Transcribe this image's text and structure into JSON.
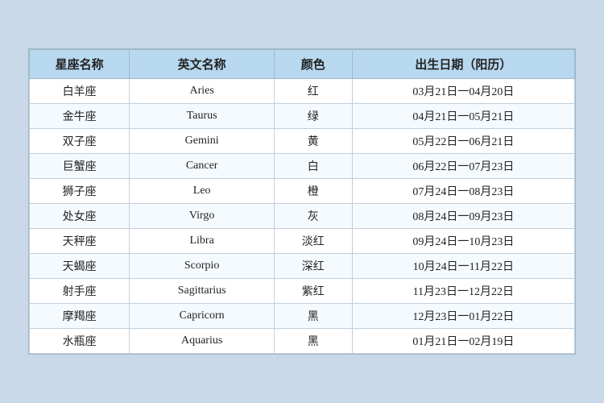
{
  "table": {
    "headers": [
      "星座名称",
      "英文名称",
      "颜色",
      "出生日期（阳历）"
    ],
    "rows": [
      {
        "zh": "白羊座",
        "en": "Aries",
        "color": "红",
        "date": "03月21日一04月20日"
      },
      {
        "zh": "金牛座",
        "en": "Taurus",
        "color": "绿",
        "date": "04月21日一05月21日"
      },
      {
        "zh": "双子座",
        "en": "Gemini",
        "color": "黄",
        "date": "05月22日一06月21日"
      },
      {
        "zh": "巨蟹座",
        "en": "Cancer",
        "color": "白",
        "date": "06月22日一07月23日"
      },
      {
        "zh": "狮子座",
        "en": "Leo",
        "color": "橙",
        "date": "07月24日一08月23日"
      },
      {
        "zh": "处女座",
        "en": "Virgo",
        "color": "灰",
        "date": "08月24日一09月23日"
      },
      {
        "zh": "天秤座",
        "en": "Libra",
        "color": "淡红",
        "date": "09月24日一10月23日"
      },
      {
        "zh": "天蝎座",
        "en": "Scorpio",
        "color": "深红",
        "date": "10月24日一11月22日"
      },
      {
        "zh": "射手座",
        "en": "Sagittarius",
        "color": "紫红",
        "date": "11月23日一12月22日"
      },
      {
        "zh": "摩羯座",
        "en": "Capricorn",
        "color": "黑",
        "date": "12月23日一01月22日"
      },
      {
        "zh": "水瓶座",
        "en": "Aquarius",
        "color": "黑",
        "date": "01月21日一02月19日"
      }
    ]
  }
}
